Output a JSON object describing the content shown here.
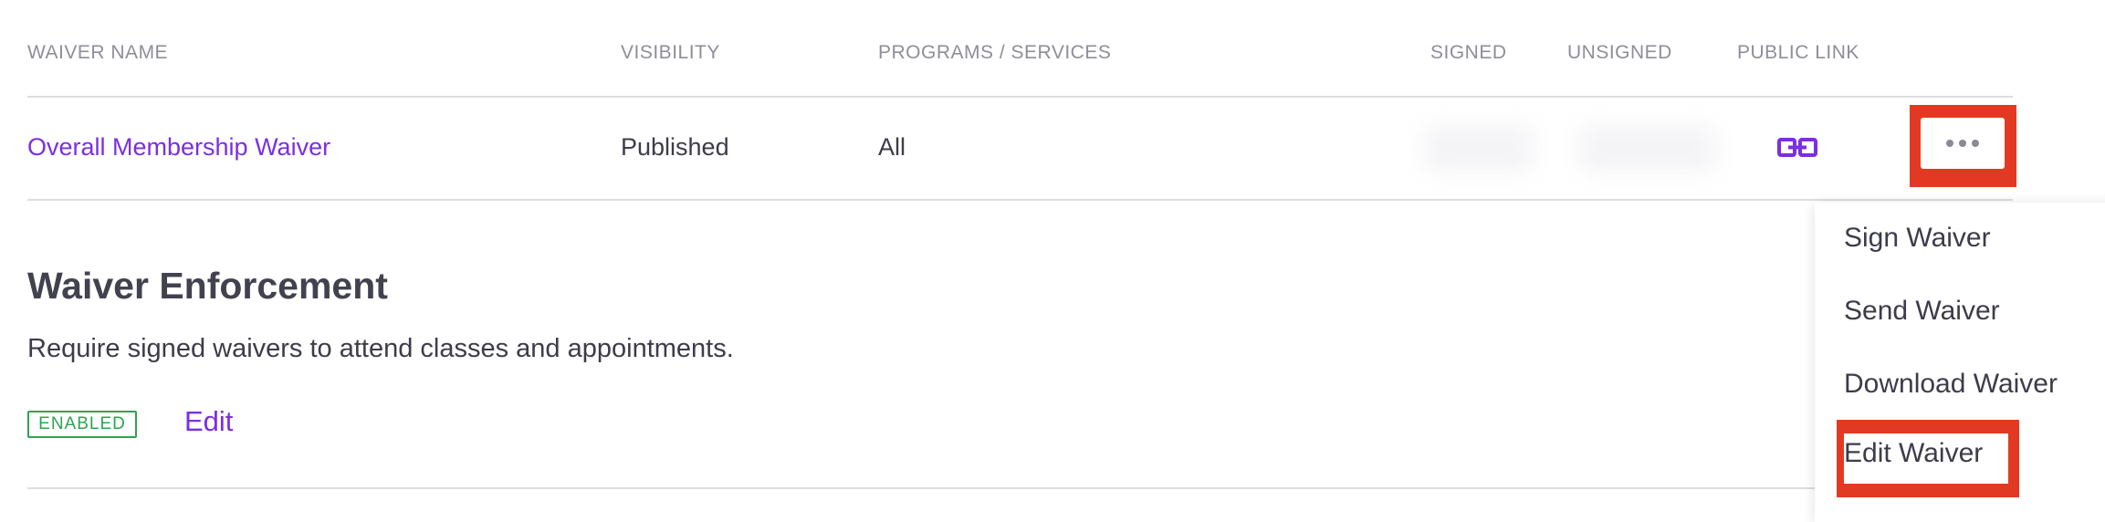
{
  "table": {
    "headers": {
      "waiver_name": "WAIVER NAME",
      "visibility": "VISIBILITY",
      "programs": "PROGRAMS / SERVICES",
      "signed": "SIGNED",
      "unsigned": "UNSIGNED",
      "public_link": "PUBLIC LINK"
    },
    "rows": [
      {
        "name": "Overall Membership Waiver",
        "visibility": "Published",
        "programs": "All"
      }
    ]
  },
  "icons": {
    "public_link": "link-icon",
    "more": "ellipsis-icon"
  },
  "enforcement": {
    "title": "Waiver Enforcement",
    "description": "Require signed waivers to attend classes and appointments.",
    "status": "ENABLED",
    "edit_label": "Edit"
  },
  "menu": {
    "items": [
      "Sign Waiver",
      "Send Waiver",
      "Download Waiver",
      "Edit Waiver"
    ]
  },
  "colors": {
    "accent": "#7b2fe0",
    "enabled": "#2ea44f",
    "highlight": "#e23a22"
  }
}
